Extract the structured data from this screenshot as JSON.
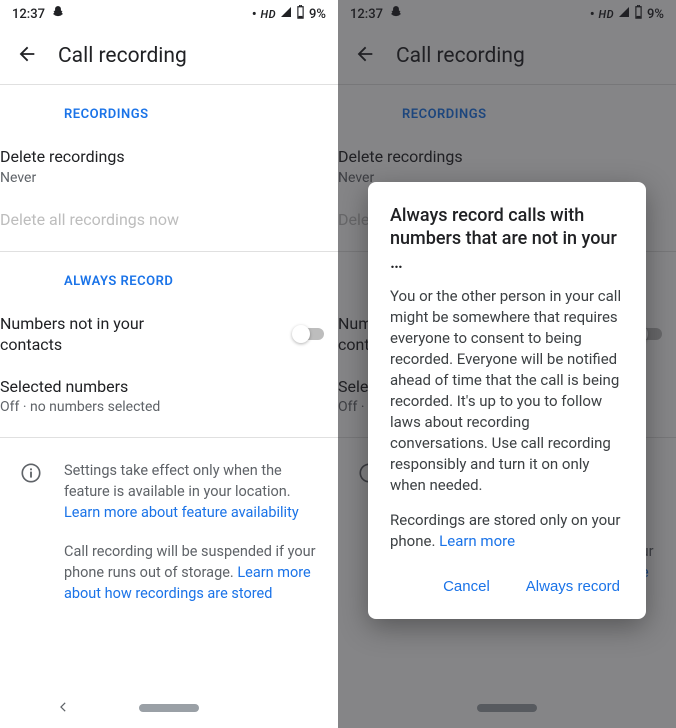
{
  "status": {
    "time": "12:37",
    "hd": "HD",
    "battery_pct": "9%"
  },
  "appbar": {
    "title": "Call recording"
  },
  "recordings": {
    "header": "RECORDINGS",
    "delete_title": "Delete recordings",
    "delete_value": "Never",
    "delete_all": "Delete all recordings now"
  },
  "always": {
    "header": "ALWAYS RECORD",
    "not_in_contacts": "Numbers not in your contacts",
    "selected_title": "Selected numbers",
    "selected_value": "Off · no numbers selected"
  },
  "info": {
    "p1a": "Settings take effect only when the feature is available in your location. ",
    "p1_link": "Learn more about feature availability",
    "p2a": "Call recording will be suspended if your phone runs out of storage. ",
    "p2_link": "Learn more about how recordings are stored"
  },
  "dialog": {
    "title": "Always record calls with numbers that are not in your …",
    "body1": "You or the other person in your call might be somewhere that requires everyone to consent to being recorded. Everyone will be notified ahead of time that the call is being recorded. It's up to you to follow laws about recording conversations. Use call recording responsibly and turn it on only when needed.",
    "body2a": "Recordings are stored only on your phone. ",
    "body2_link": "Learn more",
    "cancel": "Cancel",
    "confirm": "Always record"
  }
}
